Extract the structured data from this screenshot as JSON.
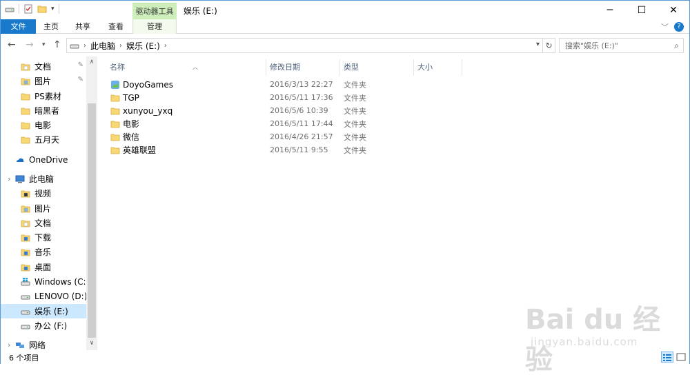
{
  "window": {
    "title": "娱乐 (E:)",
    "context_tab_group": "驱动器工具"
  },
  "ribbon": {
    "tabs": [
      "文件",
      "主页",
      "共享",
      "查看",
      "管理"
    ]
  },
  "address": {
    "segments": [
      "此电脑",
      "娱乐 (E:)"
    ],
    "search_placeholder": "搜索\"娱乐 (E:)\""
  },
  "nav": {
    "items": [
      {
        "label": "文档",
        "icon": "document-folder-icon",
        "pinned": true
      },
      {
        "label": "图片",
        "icon": "pictures-folder-icon",
        "pinned": true
      },
      {
        "label": "PS素材",
        "icon": "folder-icon"
      },
      {
        "label": "暗黑者",
        "icon": "folder-icon"
      },
      {
        "label": "电影",
        "icon": "folder-icon"
      },
      {
        "label": "五月天",
        "icon": "folder-icon"
      },
      {
        "label": "OneDrive",
        "icon": "onedrive-icon"
      },
      {
        "label": "此电脑",
        "icon": "this-pc-icon"
      },
      {
        "label": "视频",
        "icon": "videos-folder-icon"
      },
      {
        "label": "图片",
        "icon": "pictures-folder-icon"
      },
      {
        "label": "文档",
        "icon": "document-folder-icon"
      },
      {
        "label": "下载",
        "icon": "downloads-folder-icon"
      },
      {
        "label": "音乐",
        "icon": "music-folder-icon"
      },
      {
        "label": "桌面",
        "icon": "desktop-folder-icon"
      },
      {
        "label": "Windows (C:)",
        "icon": "windows-drive-icon"
      },
      {
        "label": "LENOVO (D:)",
        "icon": "drive-icon"
      },
      {
        "label": "娱乐 (E:)",
        "icon": "drive-icon",
        "selected": true
      },
      {
        "label": "办公 (F:)",
        "icon": "drive-icon"
      },
      {
        "label": "网络",
        "icon": "network-icon"
      }
    ]
  },
  "columns": [
    "名称",
    "修改日期",
    "类型",
    "大小"
  ],
  "files": [
    {
      "name": "DoyoGames",
      "date": "2016/3/13 22:27",
      "type": "文件夹",
      "icon": "app-folder-icon"
    },
    {
      "name": "TGP",
      "date": "2016/5/11 17:36",
      "type": "文件夹",
      "icon": "folder-icon"
    },
    {
      "name": "xunyou_yxq",
      "date": "2016/5/6 10:39",
      "type": "文件夹",
      "icon": "folder-icon"
    },
    {
      "name": "电影",
      "date": "2016/5/11 17:44",
      "type": "文件夹",
      "icon": "folder-icon"
    },
    {
      "name": "微信",
      "date": "2016/4/26 21:57",
      "type": "文件夹",
      "icon": "folder-icon"
    },
    {
      "name": "英雄联盟",
      "date": "2016/5/11 9:55",
      "type": "文件夹",
      "icon": "folder-icon"
    }
  ],
  "status": {
    "item_count": "6 个项目"
  },
  "watermark": {
    "brand": "Bai du 经验",
    "url": "jingyan.baidu.com"
  },
  "colors": {
    "accent": "#1979ca",
    "folder": "#f8d775",
    "selection": "#cce8ff"
  }
}
